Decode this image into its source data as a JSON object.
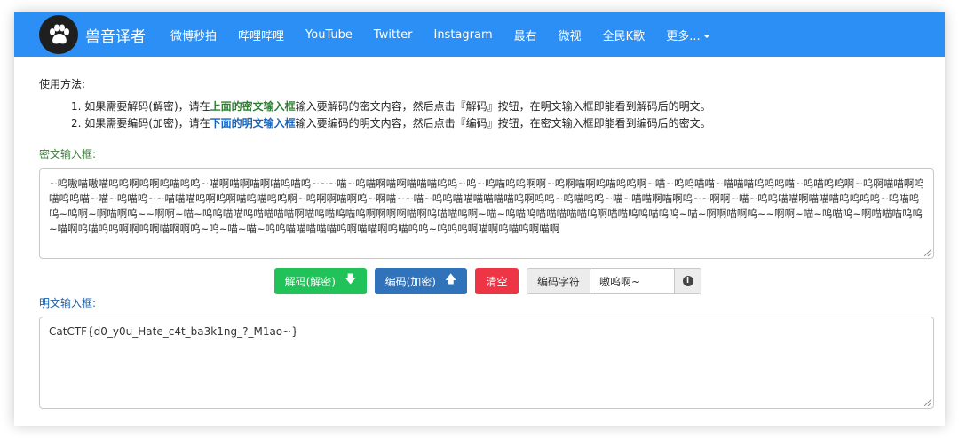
{
  "navbar": {
    "brand": "兽音译者",
    "items": [
      "微博秒拍",
      "哔哩哔哩",
      "YouTube",
      "Twitter",
      "Instagram",
      "最右",
      "微视",
      "全民K歌"
    ],
    "more": "更多...",
    "logo_icon": "paw-icon",
    "color": "#2b8ff5"
  },
  "usage": {
    "title": "使用方法:",
    "step1": {
      "prefix": "1. 如果需要解码(解密)，请在",
      "highlight": "上面的密文输入框",
      "suffix": "输入要解码的密文内容，然后点击『解码』按钮，在明文输入框即能看到解码后的明文。"
    },
    "step2": {
      "prefix": "2. 如果需要编码(加密)，请在",
      "highlight": "下面的明文输入框",
      "suffix": "输入要编码的明文内容，然后点击『编码』按钮，在密文输入框即能看到编码后的密文。"
    }
  },
  "cipher": {
    "label": "密文输入框:",
    "value": "~呜嗷喵嗷喵呜呜啊呜啊呜喵呜呜~喵啊喵啊喵啊喵呜喵呜~~~喵~呜喵啊喵啊喵喵喵呜呜~呜~呜喵呜呜啊啊~呜啊喵啊呜喵呜呜啊~喵~呜呜喵喵~喵喵喵呜呜呜喵~呜喵呜呜啊~呜啊喵喵啊呜喵呜呜喵~喵~呜喵呜~~喵喵喵呜啊呜啊喵呜喵呜呜啊~呜啊啊喵啊呜~啊喵~~喵~呜呜喵喵喵喵喵喵呜啊呜呜~呜喵呜呜~喵~喵喵啊喵啊呜~~啊啊~喵~呜呜喵喵啊喵喵喵呜呜呜呜~呜喵呜呜~呜啊~啊喵啊呜~~啊啊~喵~呜呜喵喵呜喵喵喵喵啊喵呜喵呜喵呜啊啊啊啊喵啊呜喵喵呜啊~喵~呜喵呜喵喵喵喵喵呜啊喵喵呜呜喵呜呜~喵~啊啊喵啊呜~~啊啊~喵~呜喵呜~啊喵喵喵呜呜~喵啊呜喵呜呜啊啊呜啊喵啊啊呜~呜~喵~喵~呜呜喵喵喵喵喵呜啊喵喵啊呜喵呜呜~呜呜呜啊喵啊呜喵呜啊喵啊"
  },
  "buttons": {
    "decode": "解码(解密)",
    "encode": "编码(加密)",
    "clear": "清空",
    "decode_icon": "arrow-down-icon",
    "encode_icon": "arrow-up-icon"
  },
  "charset": {
    "label": "编码字符",
    "value": "嗷呜啊~",
    "info_icon": "info-circle-icon"
  },
  "plain": {
    "label": "明文输入框:",
    "value": "CatCTF{d0_y0u_Hate_c4t_ba3k1ng_?_M1ao~}"
  }
}
